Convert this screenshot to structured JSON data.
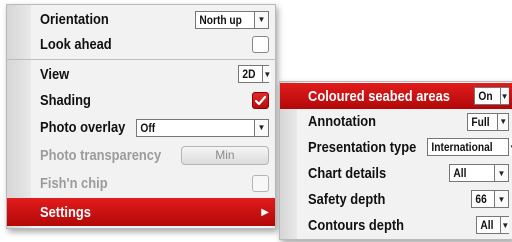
{
  "main_menu": {
    "orientation": {
      "label": "Orientation",
      "value": "North up"
    },
    "look_ahead": {
      "label": "Look ahead",
      "checked": false
    },
    "view": {
      "label": "View",
      "value": "2D"
    },
    "shading": {
      "label": "Shading",
      "checked": true
    },
    "photo_overlay": {
      "label": "Photo overlay",
      "value": "Off"
    },
    "photo_transparency": {
      "label": "Photo transparency",
      "value": "Min",
      "enabled": false
    },
    "fish_n_chip": {
      "label": "Fish'n chip",
      "checked": false,
      "enabled": false
    },
    "settings": {
      "label": "Settings",
      "selected": true
    }
  },
  "sub_menu": {
    "coloured_seabed": {
      "label": "Coloured seabed areas",
      "value": "On",
      "selected": true
    },
    "annotation": {
      "label": "Annotation",
      "value": "Full"
    },
    "presentation_type": {
      "label": "Presentation type",
      "value": "International"
    },
    "chart_details": {
      "label": "Chart details",
      "value": "All"
    },
    "safety_depth": {
      "label": "Safety depth",
      "value": "66"
    },
    "contours_depth": {
      "label": "Contours depth",
      "value": "All"
    }
  },
  "colors": {
    "accent": "#d01212",
    "menu_bg": "#f2f2f2",
    "strip": "#dddddd"
  },
  "icons": {
    "dropdown": "chevron-down-icon",
    "submenu": "chevron-right-icon",
    "check": "check-icon"
  }
}
